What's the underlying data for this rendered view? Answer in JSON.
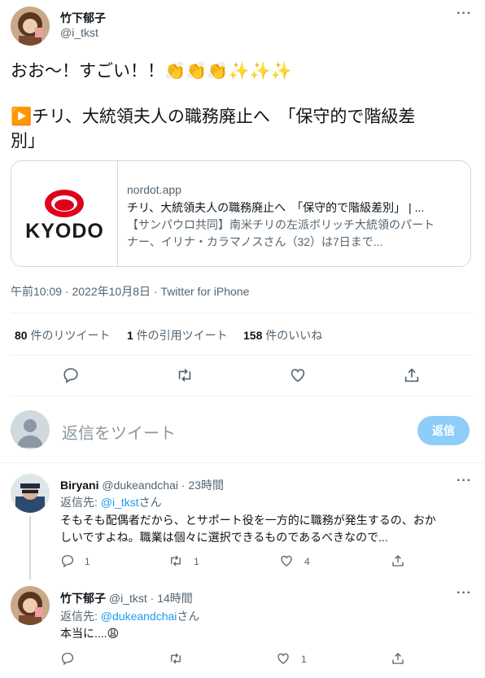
{
  "main_tweet": {
    "author_name": "竹下郁子",
    "author_handle": "@i_tkst",
    "text_line1": "おお〜！すごい！！👏👏👏✨✨✨",
    "text_line2": "▶️チリ、大統領夫人の職務廃止へ　「保守的で階級差",
    "text_line3": "別」",
    "card": {
      "logo_text": "KYODO",
      "domain": "nordot.app",
      "title": "チリ、大統領夫人の職務廃止へ　「保守的で階級差別」 | ...",
      "desc_line1": "【サンパウロ共同】南米チリの左派ボリッチ大統領のパート",
      "desc_line2": "ナー、イリナ・カラマノスさん（32）は7日まで..."
    },
    "timestamp": "午前10:09 · 2022年10月8日 · Twitter for iPhone",
    "stats": {
      "retweets_count": "80",
      "retweets_label": "件のリツイート",
      "quotes_count": "1",
      "quotes_label": "件の引用ツイート",
      "likes_count": "158",
      "likes_label": "件のいいね"
    }
  },
  "compose": {
    "placeholder": "返信をツイート",
    "button_label": "返信"
  },
  "replies": [
    {
      "author_name": "Biryani",
      "author_handle": "@dukeandchai",
      "time": "· 23時間",
      "reply_to_prefix": "返信先: ",
      "reply_to_handle": "@i_tkst",
      "reply_to_suffix": "さん",
      "text_line1": "そもそも配偶者だから、とサポート役を一方的に職務が発生するの、おか",
      "text_line2": "しいですよね。職業は個々に選択できるものであるべきなので...",
      "reply_count": "1",
      "retweet_count": "1",
      "like_count": "4"
    },
    {
      "author_name": "竹下郁子",
      "author_handle": "@i_tkst",
      "time": "· 14時間",
      "reply_to_prefix": "返信先: ",
      "reply_to_handle": "@dukeandchai",
      "reply_to_suffix": "さん",
      "text_line1": "本当に....😩",
      "reply_count": "",
      "retweet_count": "",
      "like_count": "1"
    }
  ],
  "colors": {
    "accent": "#1d9bf0",
    "muted": "#536471",
    "button_disabled": "#8ecdf8"
  }
}
